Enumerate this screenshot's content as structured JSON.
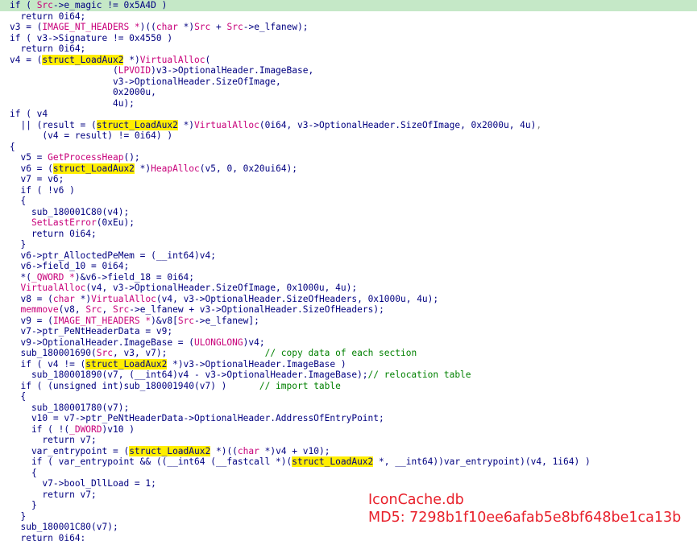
{
  "colors": {
    "plain": "#000080",
    "api": "#c8007a",
    "comment": "#008000",
    "gray": "#808080",
    "highlight": "#ffee00",
    "current_line": "#c5e8c7",
    "watermark": "#e8202b"
  },
  "code_lines": [
    [
      {
        "t": "if ( "
      },
      {
        "t": "Src",
        "c": "api"
      },
      {
        "t": "->e_magic != 0x5A4D )"
      }
    ],
    [
      {
        "t": "  return 0i64;"
      }
    ],
    [
      {
        "t": "v3 = ("
      },
      {
        "t": "IMAGE_NT_HEADERS *",
        "c": "api"
      },
      {
        "t": ")(("
      },
      {
        "t": "char",
        "c": "api"
      },
      {
        "t": " *)"
      },
      {
        "t": "Src",
        "c": "api"
      },
      {
        "t": " + "
      },
      {
        "t": "Src",
        "c": "api"
      },
      {
        "t": "->e_lfanew);"
      }
    ],
    [
      {
        "t": "if ( v3->Signature != 0x4550 )"
      }
    ],
    [
      {
        "t": "  return 0i64;"
      }
    ],
    [
      {
        "t": "v4 = ("
      },
      {
        "t": "struct_LoadAux2",
        "c": "hl"
      },
      {
        "t": " *)"
      },
      {
        "t": "VirtualAlloc",
        "c": "api"
      },
      {
        "t": "("
      }
    ],
    [
      {
        "t": "                   ("
      },
      {
        "t": "LPVOID",
        "c": "api"
      },
      {
        "t": ")v3->OptionalHeader.ImageBase,"
      }
    ],
    [
      {
        "t": "                   v3->OptionalHeader.SizeOfImage,"
      }
    ],
    [
      {
        "t": "                   0x2000u,"
      }
    ],
    [
      {
        "t": "                   4u);"
      }
    ],
    [
      {
        "t": "if ( v4"
      }
    ],
    [
      {
        "t": "  || (result = ("
      },
      {
        "t": "struct_LoadAux2",
        "c": "hl"
      },
      {
        "t": " *)"
      },
      {
        "t": "VirtualAlloc",
        "c": "api"
      },
      {
        "t": "(0i64, v3->OptionalHeader.SizeOfImage, 0x2000u, 4u)"
      },
      {
        "t": ",",
        "c": "gr"
      }
    ],
    [
      {
        "t": "      (v4 = result) != 0i64) )"
      }
    ],
    [
      {
        "t": "{"
      }
    ],
    [
      {
        "t": "  v5 = "
      },
      {
        "t": "GetProcessHeap",
        "c": "api"
      },
      {
        "t": "();"
      }
    ],
    [
      {
        "t": "  v6 = ("
      },
      {
        "t": "struct_LoadAux2",
        "c": "hl"
      },
      {
        "t": " *)"
      },
      {
        "t": "HeapAlloc",
        "c": "api"
      },
      {
        "t": "(v5, 0, 0x20ui64);"
      }
    ],
    [
      {
        "t": "  v7 = v6;"
      }
    ],
    [
      {
        "t": "  if ( !v6 )"
      }
    ],
    [
      {
        "t": "  {"
      }
    ],
    [
      {
        "t": "    sub_180001C80(v4);"
      }
    ],
    [
      {
        "t": "    "
      },
      {
        "t": "SetLastError",
        "c": "api"
      },
      {
        "t": "(0xEu);"
      }
    ],
    [
      {
        "t": "    return 0i64;"
      }
    ],
    [
      {
        "t": "  }"
      }
    ],
    [
      {
        "t": "  v6->ptr_AlloctedPeMem = (__int64)v4;"
      }
    ],
    [
      {
        "t": "  v6->field_10 = 0i64;"
      }
    ],
    [
      {
        "t": "  *("
      },
      {
        "t": "_QWORD *",
        "c": "api"
      },
      {
        "t": ")&v6->field_18 = 0i64;"
      }
    ],
    [
      {
        "t": "  "
      },
      {
        "t": "VirtualAlloc",
        "c": "api"
      },
      {
        "t": "(v4, v3->OptionalHeader.SizeOfImage, 0x1000u, 4u);"
      }
    ],
    [
      {
        "t": "  v8 = ("
      },
      {
        "t": "char",
        "c": "api"
      },
      {
        "t": " *)"
      },
      {
        "t": "VirtualAlloc",
        "c": "api"
      },
      {
        "t": "(v4, v3->OptionalHeader.SizeOfHeaders, 0x1000u, 4u);"
      }
    ],
    [
      {
        "t": "  "
      },
      {
        "t": "memmove",
        "c": "api"
      },
      {
        "t": "(v8, "
      },
      {
        "t": "Src",
        "c": "api"
      },
      {
        "t": ", "
      },
      {
        "t": "Src",
        "c": "api"
      },
      {
        "t": "->e_lfanew + v3->OptionalHeader.SizeOfHeaders);"
      }
    ],
    [
      {
        "t": "  v9 = ("
      },
      {
        "t": "IMAGE_NT_HEADERS *",
        "c": "api"
      },
      {
        "t": ")&v8["
      },
      {
        "t": "Src",
        "c": "api"
      },
      {
        "t": "->e_lfanew];"
      }
    ],
    [
      {
        "t": "  v7->ptr_PeNtHeaderData = v9;"
      }
    ],
    [
      {
        "t": "  v9->OptionalHeader.ImageBase = ("
      },
      {
        "t": "ULONGLONG",
        "c": "api"
      },
      {
        "t": ")v4;"
      }
    ],
    [
      {
        "t": "  sub_180001690("
      },
      {
        "t": "Src",
        "c": "api"
      },
      {
        "t": ", v3, v7);"
      },
      {
        "t": "                  // copy data of each section",
        "c": "cm"
      }
    ],
    [
      {
        "t": "  if ( v4 != ("
      },
      {
        "t": "struct_LoadAux2",
        "c": "hl"
      },
      {
        "t": " *)v3->OptionalHeader.ImageBase )"
      }
    ],
    [
      {
        "t": "    sub_180001890(v7, (__int64)v4 - v3->OptionalHeader.ImageBase);"
      },
      {
        "t": "// relocation table",
        "c": "cm"
      }
    ],
    [
      {
        "t": "  if ( (unsigned int)sub_180001940(v7) )"
      },
      {
        "t": "      // import table",
        "c": "cm"
      }
    ],
    [
      {
        "t": "  {"
      }
    ],
    [
      {
        "t": "    sub_180001780(v7);"
      }
    ],
    [
      {
        "t": "    v10 = v7->ptr_PeNtHeaderData->OptionalHeader.AddressOfEntryPoint;"
      }
    ],
    [
      {
        "t": "    if ( !("
      },
      {
        "t": "_DWORD",
        "c": "api"
      },
      {
        "t": ")v10 )"
      }
    ],
    [
      {
        "t": "      return v7;"
      }
    ],
    [
      {
        "t": "    var_entrypoint = ("
      },
      {
        "t": "struct_LoadAux2",
        "c": "hl"
      },
      {
        "t": " *)(("
      },
      {
        "t": "char",
        "c": "api"
      },
      {
        "t": " *)v4 + v10);"
      }
    ],
    [
      {
        "t": "    if ( var_entrypoint && ((__int64 (__fastcall *)("
      },
      {
        "t": "struct_LoadAux2",
        "c": "hl"
      },
      {
        "t": " *, __int64))var_entrypoint)(v4, 1i64) )"
      }
    ],
    [
      {
        "t": "    {"
      }
    ],
    [
      {
        "t": "      v7->bool_DllLoad = 1;"
      }
    ],
    [
      {
        "t": "      return v7;"
      }
    ],
    [
      {
        "t": "    }"
      }
    ],
    [
      {
        "t": "  }"
      }
    ],
    [
      {
        "t": "  sub_180001C80(v7);"
      }
    ],
    [
      {
        "t": "  return 0i64;"
      }
    ]
  ],
  "watermark": {
    "line1": "IconCache.db",
    "line2": "MD5: 7298b1f10ee6afab5e8bf648be1ca13b"
  }
}
